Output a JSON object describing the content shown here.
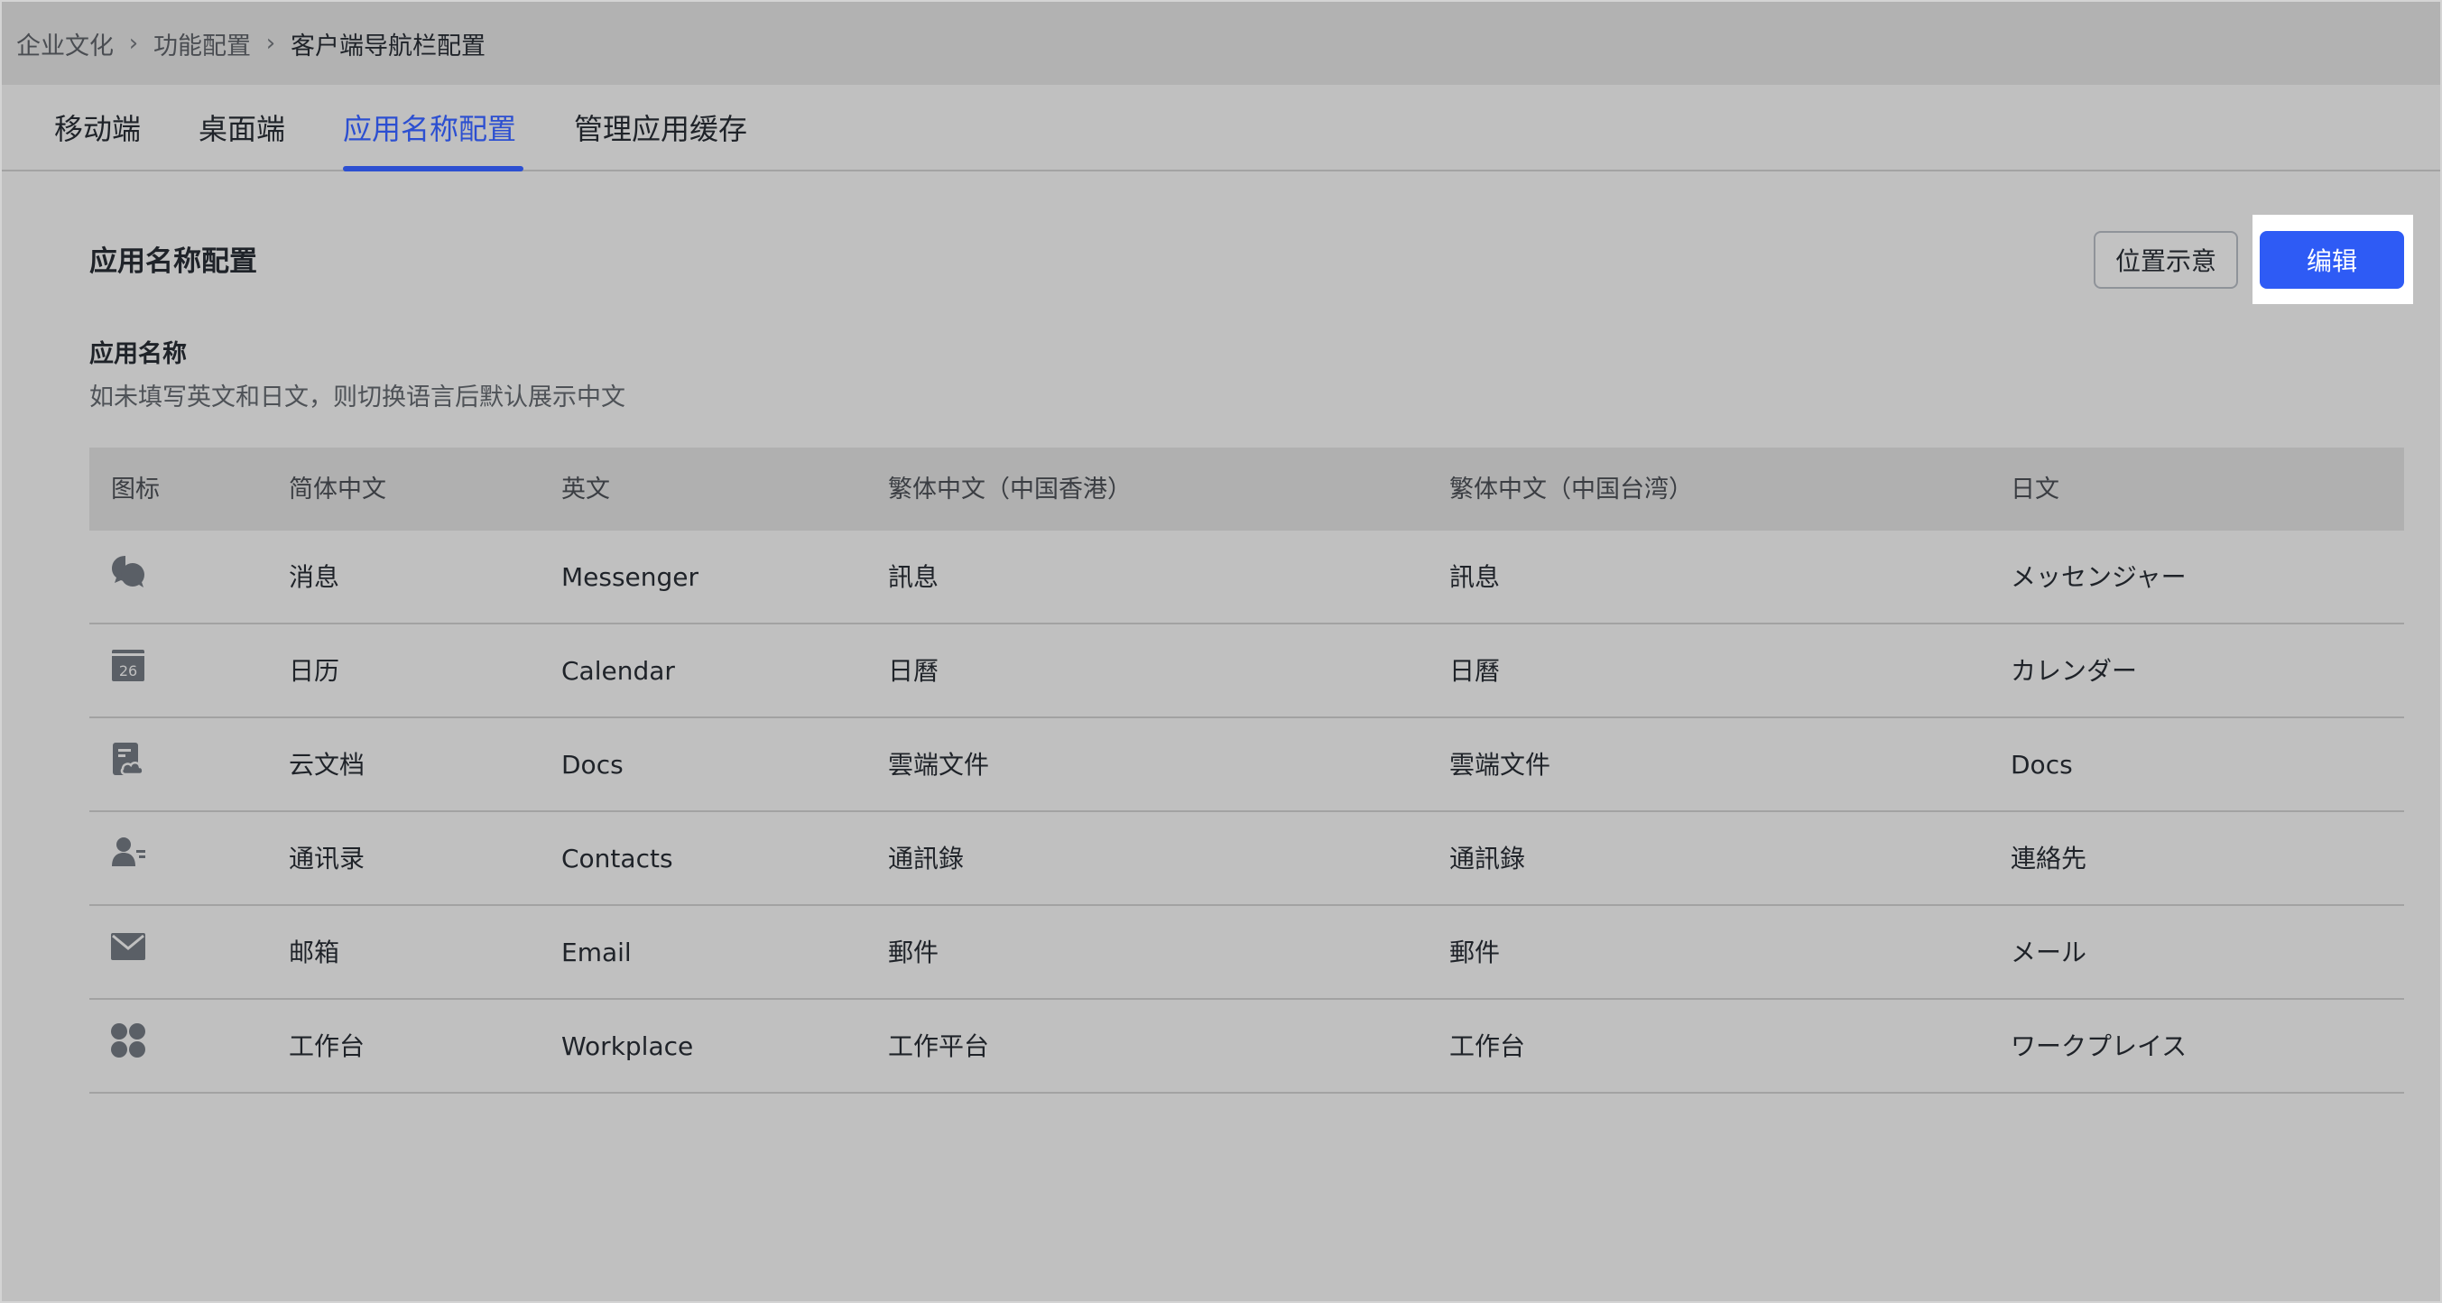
{
  "breadcrumb": {
    "items": [
      "企业文化",
      "功能配置",
      "客户端导航栏配置"
    ],
    "separator": "›"
  },
  "tabs": [
    {
      "label": "移动端",
      "active": false
    },
    {
      "label": "桌面端",
      "active": false
    },
    {
      "label": "应用名称配置",
      "active": true
    },
    {
      "label": "管理应用缓存",
      "active": false
    }
  ],
  "section": {
    "title": "应用名称配置",
    "position_button": "位置示意",
    "edit_button": "编辑"
  },
  "app_name": {
    "title": "应用名称",
    "description": "如未填写英文和日文，则切换语言后默认展示中文"
  },
  "table": {
    "headers": [
      "图标",
      "简体中文",
      "英文",
      "繁体中文（中国香港）",
      "繁体中文（中国台湾）",
      "日文"
    ],
    "rows": [
      {
        "icon": "messenger-icon",
        "zh_cn": "消息",
        "en": "Messenger",
        "zh_hk": "訊息",
        "zh_tw": "訊息",
        "ja": "メッセンジャー"
      },
      {
        "icon": "calendar-icon",
        "zh_cn": "日历",
        "en": "Calendar",
        "zh_hk": "日曆",
        "zh_tw": "日曆",
        "ja": "カレンダー"
      },
      {
        "icon": "docs-icon",
        "zh_cn": "云文档",
        "en": "Docs",
        "zh_hk": "雲端文件",
        "zh_tw": "雲端文件",
        "ja": "Docs"
      },
      {
        "icon": "contacts-icon",
        "zh_cn": "通讯录",
        "en": "Contacts",
        "zh_hk": "通訊錄",
        "zh_tw": "通訊錄",
        "ja": "連絡先"
      },
      {
        "icon": "email-icon",
        "zh_cn": "邮箱",
        "en": "Email",
        "zh_hk": "郵件",
        "zh_tw": "郵件",
        "ja": "メール"
      },
      {
        "icon": "workplace-icon",
        "zh_cn": "工作台",
        "en": "Workplace",
        "zh_hk": "工作平台",
        "zh_tw": "工作台",
        "ja": "ワークプレイス"
      }
    ]
  },
  "calendar_icon_day": "26",
  "colors": {
    "accent": "#2e5bf5",
    "active_tab": "#2c4fd1",
    "icon": "#5a5f66"
  }
}
